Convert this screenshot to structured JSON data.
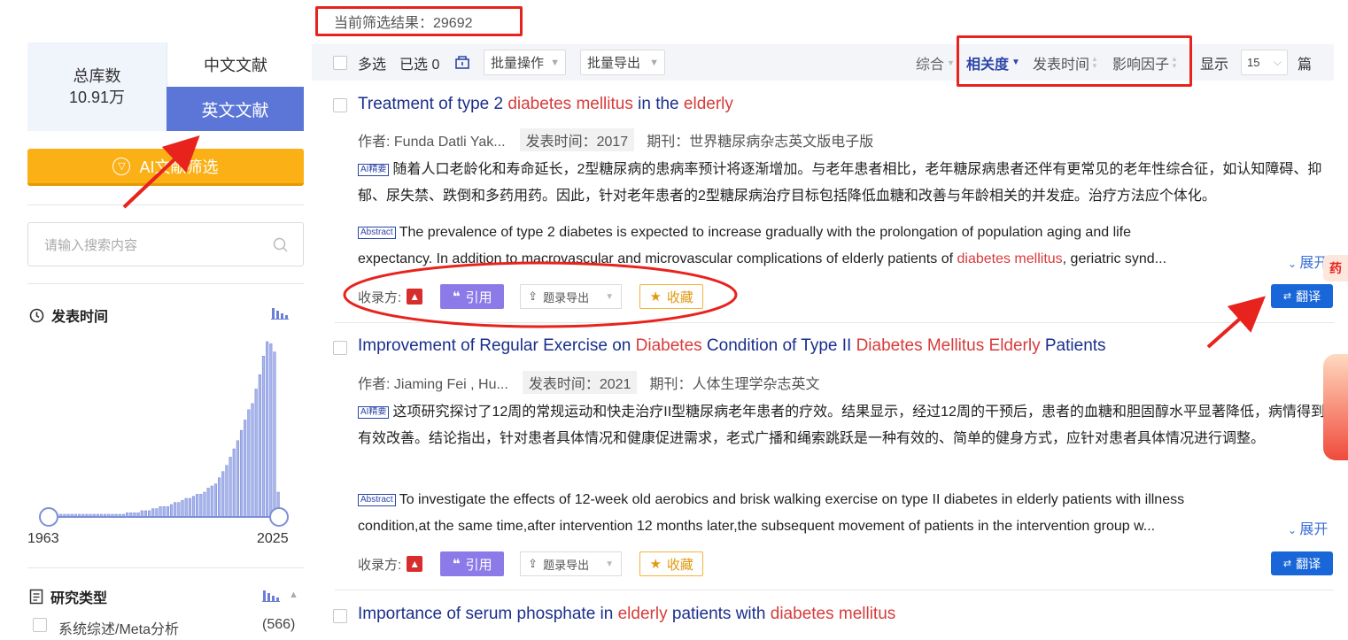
{
  "library": {
    "total_label": "总库数",
    "total_value": "10.91万",
    "tab_cn": "中文文献",
    "tab_en": "英文文献"
  },
  "ai_filter_label": "AI文献筛选",
  "search": {
    "placeholder": "请输入搜索内容"
  },
  "pub_time": {
    "title": "发表时间",
    "year_start": "1963",
    "year_end": "2025",
    "histogram": [
      1,
      1,
      1,
      1,
      1,
      1,
      1,
      1,
      1,
      1,
      1,
      1,
      1,
      1,
      1,
      1,
      1,
      1,
      1,
      1,
      1,
      2,
      2,
      2,
      2,
      3,
      3,
      3,
      4,
      4,
      5,
      5,
      5,
      6,
      7,
      7,
      8,
      9,
      9,
      10,
      11,
      11,
      12,
      14,
      15,
      16,
      19,
      22,
      25,
      29,
      33,
      37,
      42,
      47,
      52,
      55,
      62,
      69,
      78,
      85,
      84,
      80,
      12
    ]
  },
  "research_type": {
    "title": "研究类型",
    "items": [
      {
        "label": "系统综述/Meta分析",
        "count": "(566)"
      }
    ]
  },
  "results_header": "当前筛选结果：29692",
  "toolbar": {
    "multi_select": "多选",
    "selected": "已选 0",
    "batch_ops": "批量操作",
    "batch_export": "批量导出",
    "sort_overall": "综合",
    "sort_relevance": "相关度",
    "sort_date": "发表时间",
    "sort_impact": "影响因子",
    "display": "显示",
    "page_size": "15",
    "unit": "篇"
  },
  "actions": {
    "source_label": "收录方:",
    "cite": "引用",
    "export": "题录导出",
    "favorite": "收藏",
    "translate": "翻译",
    "expand": "展开"
  },
  "results": [
    {
      "title_parts": [
        {
          "t": "Treatment of type 2 ",
          "h": false
        },
        {
          "t": "diabetes mellitus",
          "h": true
        },
        {
          "t": " in the ",
          "h": false
        },
        {
          "t": "elderly",
          "h": true
        }
      ],
      "authors": "作者:  Funda Datli Yak...",
      "date": "发表时间：2017",
      "journal": "期刊：世界糖尿病杂志英文版电子版",
      "ai_tag": "AI精要",
      "ai_summary": "随着人口老龄化和寿命延长，2型糖尿病的患病率预计将逐渐增加。与老年患者相比，老年糖尿病患者还伴有更常见的老年性综合征，如认知障碍、抑郁、尿失禁、跌倒和多药用药。因此，针对老年患者的2型糖尿病治疗目标包括降低血糖和改善与年龄相关的并发症。治疗方法应个体化。",
      "abs_tag": "Abstract",
      "abstract_line1": "The prevalence of type 2 diabetes is expected to increase gradually with the prolongation of population aging and life",
      "abstract_line2_parts": [
        {
          "t": "expectancy. In addition to macrovascular and microvascular complications of elderly patients of ",
          "h": false
        },
        {
          "t": "diabetes mellitus",
          "h": true
        },
        {
          "t": ", geriatric synd...",
          "h": false
        }
      ]
    },
    {
      "title_parts": [
        {
          "t": "Improvement of Regular Exercise on ",
          "h": false
        },
        {
          "t": "Diabetes",
          "h": true
        },
        {
          "t": " Condition of Type II ",
          "h": false
        },
        {
          "t": "Diabetes Mellitus Elderly",
          "h": true
        },
        {
          "t": " Patients",
          "h": false
        }
      ],
      "authors": "作者:  Jiaming Fei , Hu...",
      "date": "发表时间：2021",
      "journal": "期刊：人体生理学杂志英文",
      "ai_tag": "AI精要",
      "ai_summary": "这项研究探讨了12周的常规运动和快走治疗II型糖尿病老年患者的疗效。结果显示，经过12周的干预后，患者的血糖和胆固醇水平显著降低，病情得到有效改善。结论指出，针对患者具体情况和健康促进需求，老式广播和绳索跳跃是一种有效的、简单的健身方式，应针对患者具体情况进行调整。",
      "abs_tag": "Abstract",
      "abstract_line1": "To investigate the effects of 12-week old aerobics and brisk walking exercise on type II diabetes in elderly patients with illness",
      "abstract_line2_parts": [
        {
          "t": "condition,at the same time,after intervention 12 months later,the subsequent movement of patients in the intervention group w...",
          "h": false
        }
      ]
    },
    {
      "title_parts": [
        {
          "t": "Importance of serum phosphate in ",
          "h": false
        },
        {
          "t": "elderly",
          "h": true
        },
        {
          "t": " patients with ",
          "h": false
        },
        {
          "t": "diabetes mellitus",
          "h": true
        }
      ]
    }
  ],
  "colors": {
    "accent": "#5b76d6",
    "highlight": "#d83b3b",
    "annotation_red": "#e8231d",
    "ai_button": "#fbb016",
    "translate_button": "#1966d8"
  }
}
